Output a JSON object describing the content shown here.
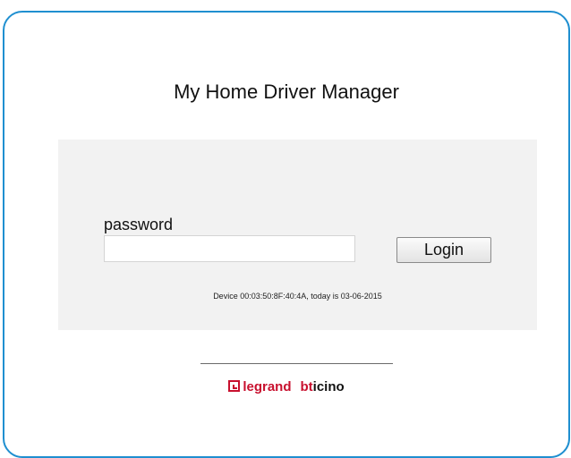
{
  "app": {
    "title": "My Home Driver Manager"
  },
  "login": {
    "password_label": "password",
    "password_value": "",
    "password_placeholder": "",
    "login_button": "Login"
  },
  "device": {
    "info_text": "Device 00:03:50:8F:40:4A, today is 03-06-2015"
  },
  "footer": {
    "brand_legrand": "legrand",
    "brand_bticino_first": "bt",
    "brand_bticino_rest": "icino"
  },
  "colors": {
    "frame_border": "#1f8fd0",
    "brand_red": "#c8102e",
    "panel_bg": "#f2f2f2"
  }
}
